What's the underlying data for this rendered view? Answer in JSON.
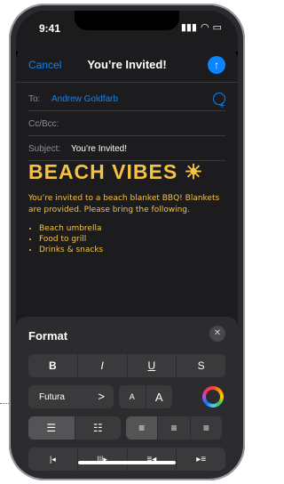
{
  "status": {
    "time": "9:41",
    "signal": "▮▮▮",
    "wifi": "◠",
    "battery": "▭"
  },
  "mail": {
    "cancel": "Cancel",
    "title": "You’re Invited!",
    "send_icon": "arrow-up-icon",
    "to_label": "To:",
    "to_value": "Andrew Goldfarb",
    "cc_label": "Cc/Bcc:",
    "subject_label": "Subject:",
    "subject_value": "You’re Invited!"
  },
  "body": {
    "headline": "BEACH VIBES ☀",
    "paragraph": "You’re invited to a beach blanket BBQ! Blankets are provided. Please bring the following.",
    "items": [
      "Beach umbrella",
      "Food to grill",
      "Drinks & snacks"
    ]
  },
  "format": {
    "title": "Format",
    "close": "✕",
    "styles": [
      "B",
      "I",
      "U",
      "S"
    ],
    "font_name": "Futura",
    "font_chevron": ">",
    "size_small": "A",
    "size_large": "A",
    "lists": [
      "☰",
      "☷"
    ],
    "align": [
      "≡",
      "≡",
      "≡"
    ],
    "indent": [
      "|◂",
      "|||▸",
      "≡◂",
      "▸≡"
    ]
  },
  "colors": {
    "accent": "#0a84ff",
    "headline": "#f5c242"
  }
}
